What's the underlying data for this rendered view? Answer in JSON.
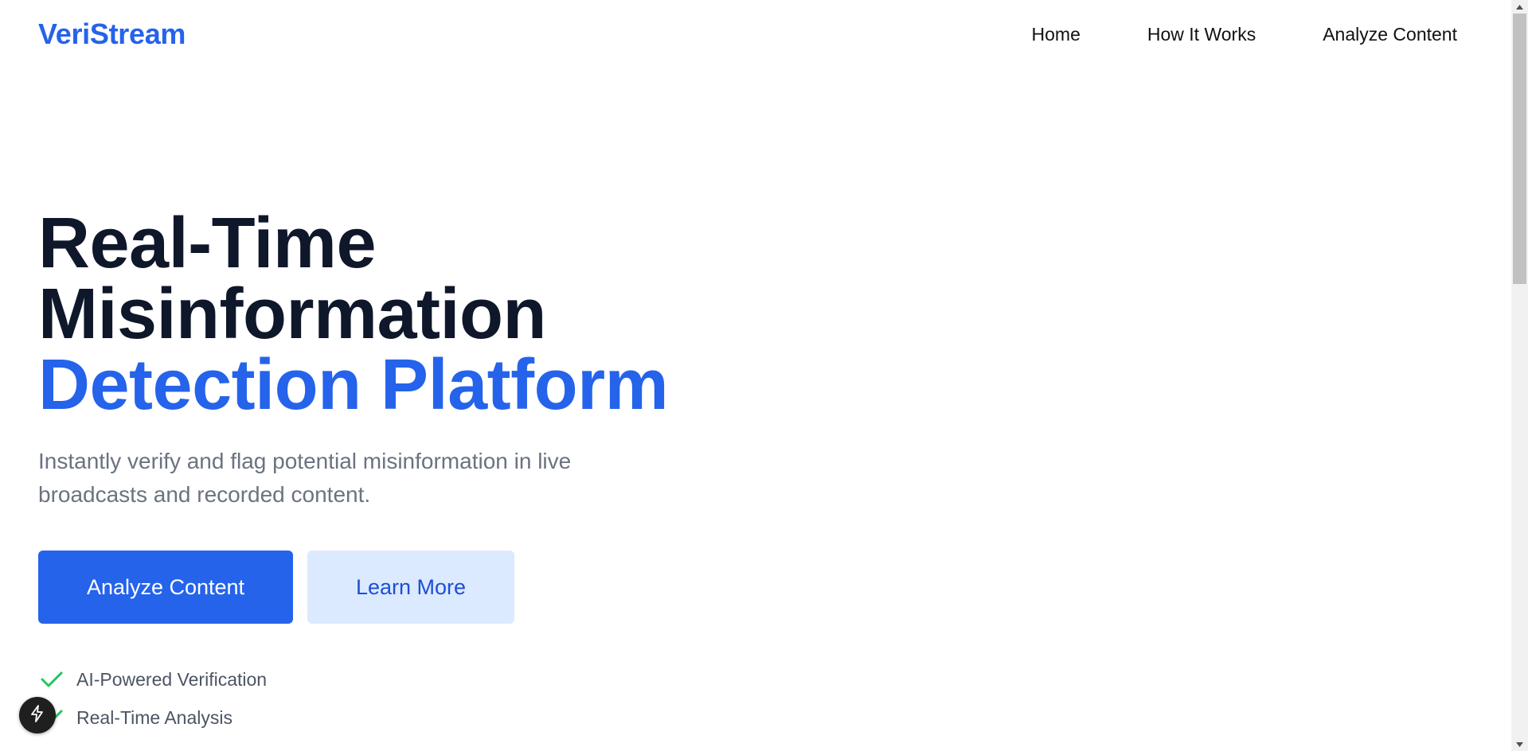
{
  "header": {
    "logo": "VeriStream",
    "nav": {
      "home": "Home",
      "how_it_works": "How It Works",
      "analyze_content": "Analyze Content"
    }
  },
  "hero": {
    "title_line1": "Real-Time",
    "title_line2": "Misinformation",
    "title_line3": "Detection Platform",
    "subtitle": "Instantly verify and flag potential misinformation in live broadcasts and recorded content.",
    "primary_button": "Analyze Content",
    "secondary_button": "Learn More",
    "features": [
      "AI-Powered Verification",
      "Real-Time Analysis"
    ]
  },
  "icons": {
    "feature": "check-icon",
    "fab": "lightning-bolt-icon"
  },
  "colors": {
    "brand": "#2563eb",
    "heading": "#0f172a",
    "muted": "#6b7280",
    "secondary_bg": "#dbeafe",
    "check": "#22c55e"
  }
}
